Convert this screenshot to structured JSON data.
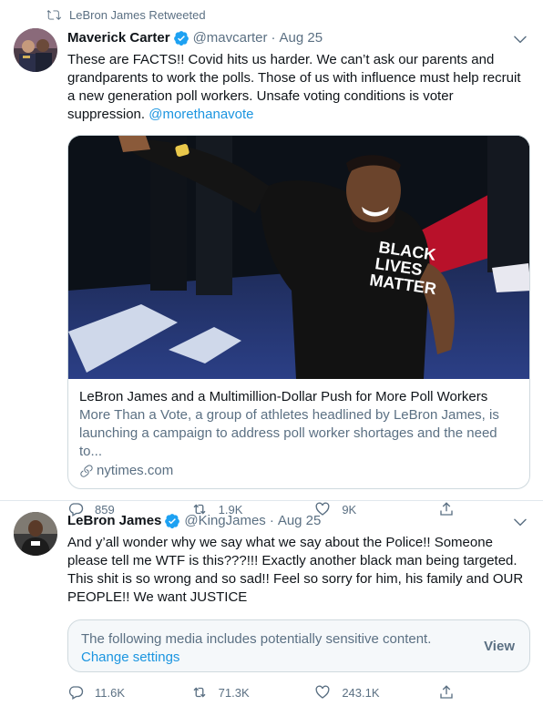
{
  "tweets": [
    {
      "retweet_label": "LeBron James Retweeted",
      "name": "Maverick Carter",
      "handle": "@mavcarter",
      "dot": "·",
      "date": "Aug 25",
      "text": "These are FACTS!! Covid hits us harder.  We can’t ask our parents and grandparents to work the polls.  Those of us with influence must help recruit a new generation poll workers.  Unsafe voting conditions is voter suppression. ",
      "mention": "@morethanavote",
      "card": {
        "shirt_line1": "BLACK",
        "shirt_line2": "LIVES",
        "shirt_line3": "MATTER",
        "title": "LeBron James and a Multimillion-Dollar Push for More Poll Workers",
        "description": "More Than a Vote, a group of athletes headlined by LeBron James, is launching a campaign to address poll worker shortages and the need to...",
        "domain": "nytimes.com"
      },
      "actions": {
        "replies": "859",
        "retweets": "1.9K",
        "likes": "9K"
      }
    },
    {
      "name": "LeBron James",
      "handle": "@KingJames",
      "dot": "·",
      "date": "Aug 25",
      "text": "And y’all wonder why we say what we say about the Police!! Someone please tell me WTF is this???!!! Exactly another black man being targeted. This shit is so wrong and so sad!! Feel so sorry for him, his family and OUR PEOPLE!! We want JUSTICE",
      "sensitive": {
        "message": "The following media includes potentially sensitive content.",
        "link": "Change settings",
        "button": "View"
      },
      "actions": {
        "replies": "11.6K",
        "retweets": "71.3K",
        "likes": "243.1K"
      }
    }
  ],
  "colors": {
    "accent": "#1da1f2",
    "link": "#1b95e0",
    "muted": "#5b7083",
    "divider": "#e1e8ed"
  },
  "icons": [
    "retweet-icon",
    "verified-badge-icon",
    "chevron-down-icon",
    "reply-icon",
    "like-icon",
    "share-icon",
    "link-icon"
  ]
}
